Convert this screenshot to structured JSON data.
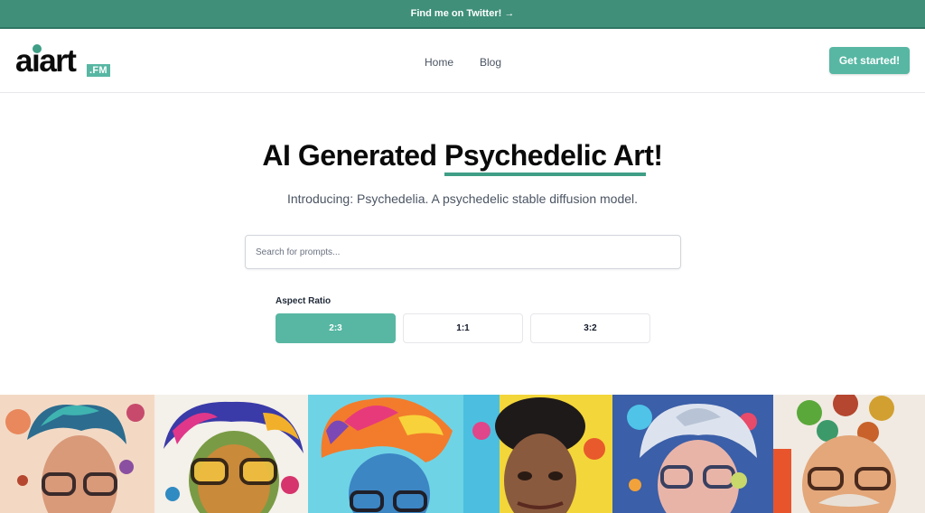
{
  "announcement": {
    "text": "Find me on Twitter! →"
  },
  "brand": {
    "name": "aiart",
    "badge": ".FM",
    "accent": "#3f9e86",
    "button_color": "#57b7a3",
    "banner_color": "#3f8f79"
  },
  "nav": {
    "links": [
      "Home",
      "Blog"
    ],
    "cta": "Get started!"
  },
  "hero": {
    "title_plain": "AI Generated ",
    "title_highlight": "Psychedelic Art",
    "title_end": "!",
    "subtitle": "Introducing: Psychedelia. A psychedelic stable diffusion model."
  },
  "search": {
    "placeholder": "Search for prompts...",
    "value": ""
  },
  "aspect_ratio": {
    "label": "Aspect Ratio",
    "options": [
      "2:3",
      "1:1",
      "3:2"
    ],
    "selected": "2:3"
  },
  "gallery": {
    "images": [
      "psychedelic portrait with glasses",
      "psychedelic portrait with aviator glasses",
      "psychedelic portrait with colorful hair",
      "psychedelic portrait with afro",
      "psychedelic portrait of elderly man",
      "psychedelic portrait with mustache and glasses"
    ]
  }
}
